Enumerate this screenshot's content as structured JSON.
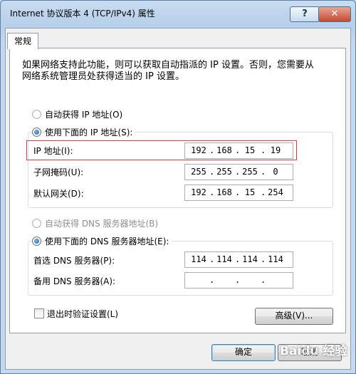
{
  "window": {
    "title": "Internet 协议版本 4 (TCP/IPv4) 属性",
    "help_label": "?",
    "close_label": "✕"
  },
  "tab": {
    "label": "常规"
  },
  "description": "如果网络支持此功能，则可以获取自动指派的 IP 设置。否则，您需要从网络系统管理员处获得适当的 IP 设置。",
  "ip_section": {
    "auto_label": "自动获得 IP 地址(O)",
    "manual_label": "使用下面的 IP 地址(S):",
    "selected": "manual",
    "ip_label": "IP 地址(I):",
    "ip_octets": [
      "192",
      "168",
      "15",
      "19"
    ],
    "mask_label": "子网掩码(U):",
    "mask_octets": [
      "255",
      "255",
      "255",
      "0"
    ],
    "gateway_label": "默认网关(D):",
    "gateway_octets": [
      "192",
      "168",
      "15",
      "254"
    ]
  },
  "dns_section": {
    "auto_label": "自动获得 DNS 服务器地址(B)",
    "manual_label": "使用下面的 DNS 服务器地址(E):",
    "selected": "manual",
    "preferred_label": "首选 DNS 服务器(P):",
    "preferred_octets": [
      "114",
      "114",
      "114",
      "114"
    ],
    "alternate_label": "备用 DNS 服务器(A):",
    "alternate_octets": [
      "",
      "",
      "",
      ""
    ]
  },
  "validate_label": "退出时验证设置(L)",
  "validate_checked": false,
  "advanced_label": "高级(V)...",
  "ok_label": "确定",
  "cancel_label": "取消",
  "watermark": "Baidu 经验"
}
